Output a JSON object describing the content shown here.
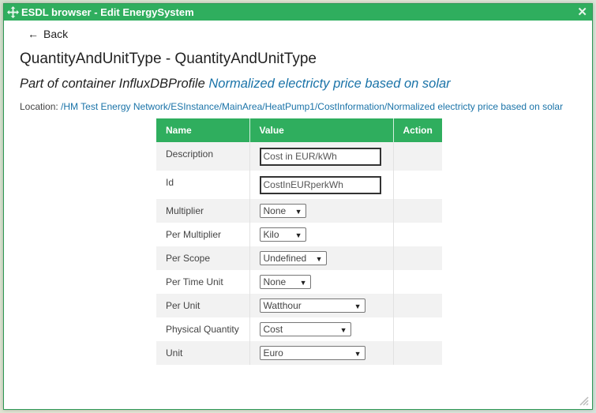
{
  "window": {
    "title": "ESDL browser - Edit EnergySystem",
    "close_label": "✕"
  },
  "back_label": "Back",
  "heading": "QuantityAndUnitType - QuantityAndUnitType",
  "container": {
    "prefix": "Part of container InfluxDBProfile",
    "link": "Normalized electricty price based on solar"
  },
  "location": {
    "label": "Location:",
    "path": "/HM Test Energy Network/ESInstance/MainArea/HeatPump1/CostInformation/Normalized electricty price based on solar"
  },
  "table": {
    "headers": [
      "Name",
      "Value",
      "Action"
    ],
    "rows": [
      {
        "name": "Description",
        "value": "Cost in EUR/kWh"
      },
      {
        "name": "Id",
        "value": "CostInEURperkWh"
      },
      {
        "name": "Multiplier",
        "value": "None"
      },
      {
        "name": "Per Multiplier",
        "value": "Kilo"
      },
      {
        "name": "Per Scope",
        "value": "Undefined"
      },
      {
        "name": "Per Time Unit",
        "value": "None"
      },
      {
        "name": "Per Unit",
        "value": "Watthour"
      },
      {
        "name": "Physical Quantity",
        "value": "Cost"
      },
      {
        "name": "Unit",
        "value": "Euro"
      }
    ]
  },
  "colors": {
    "title_bar": "#2fae5e",
    "link": "#1a73a8"
  },
  "icons": {
    "title_bar": "move-icon",
    "close": "close-icon",
    "back": "arrow-left-icon",
    "select": "chevron-down-icon",
    "resize": "resize-handle-icon"
  }
}
